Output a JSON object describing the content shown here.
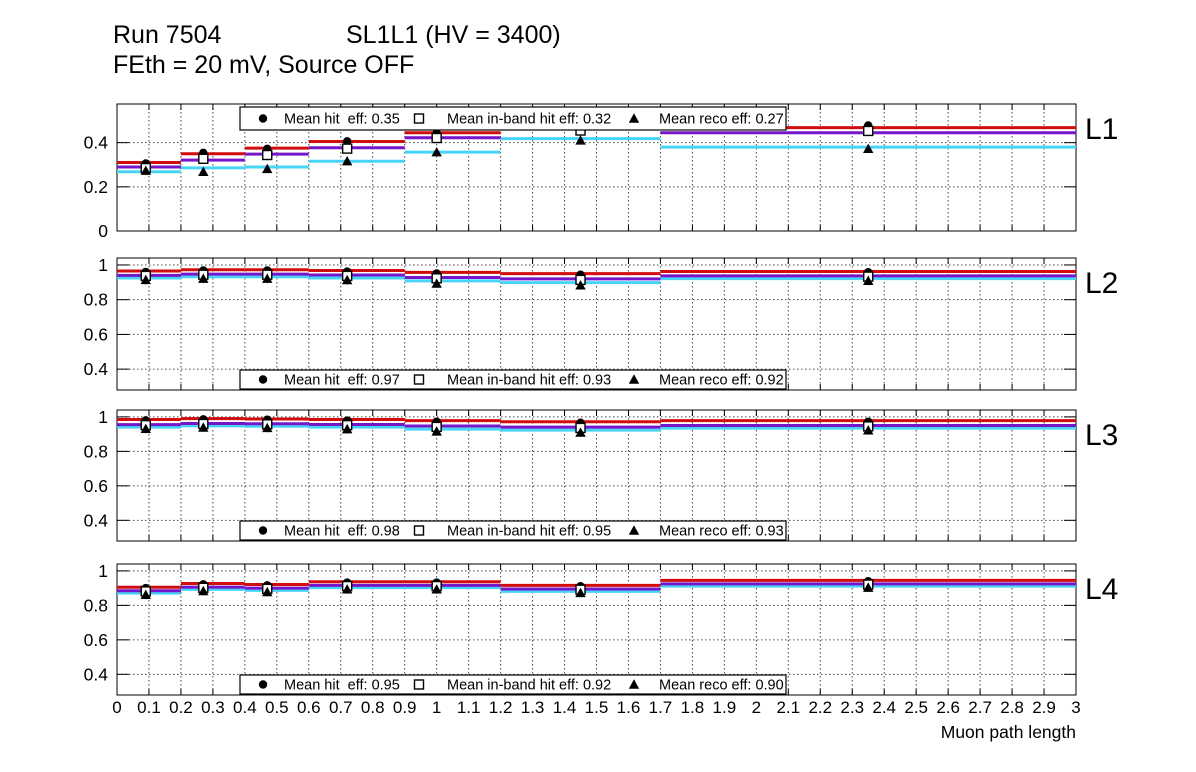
{
  "header": {
    "run_title": "Run 7504",
    "chamber_title": "SL1L1 (HV = 3400)",
    "subtitle": "FEth = 20 mV, Source OFF"
  },
  "colors": {
    "hit_line": "#d10d0d",
    "inband_line": "#7715c9",
    "reco_line": "#47d4f7",
    "marker": "#000000",
    "grid": "#444444"
  },
  "chart_data": {
    "type": "line",
    "xlabel": "Muon path length",
    "xlim": [
      0,
      3
    ],
    "grid": true,
    "x_tick_labels": [
      "0",
      "0.1",
      "0.2",
      "0.3",
      "0.4",
      "0.5",
      "0.6",
      "0.7",
      "0.8",
      "0.9",
      "1",
      "1.1",
      "1.2",
      "1.3",
      "1.4",
      "1.5",
      "1.6",
      "1.7",
      "1.8",
      "1.9",
      "2",
      "2.1",
      "2.2",
      "2.3",
      "2.4",
      "2.5",
      "2.6",
      "2.7",
      "2.8",
      "2.9",
      "3"
    ],
    "bin_edges": [
      0,
      0.2,
      0.4,
      0.6,
      0.9,
      1.2,
      1.7,
      3.0
    ],
    "marker_x": [
      0.09,
      0.27,
      0.47,
      0.72,
      1.0,
      1.45,
      2.35
    ],
    "series_names": [
      "hit",
      "in-band hit",
      "reco"
    ],
    "panels": [
      {
        "label": "L1",
        "ylim": [
          0,
          0.575
        ],
        "yticks": [
          0,
          0.2,
          0.4
        ],
        "ytick_labels": [
          "0",
          "0.2",
          "0.4"
        ],
        "legend_position": "top",
        "legend": [
          {
            "marker": "filled-circle",
            "label": "Mean hit  eff: 0.35"
          },
          {
            "marker": "open-square",
            "label": "Mean in-band hit eff: 0.32"
          },
          {
            "marker": "filled-triangle",
            "label": "Mean reco eff: 0.27"
          }
        ],
        "lines": {
          "hit": [
            0.31,
            0.35,
            0.375,
            0.405,
            0.445,
            0.468,
            0.468
          ],
          "inband": [
            0.29,
            0.321,
            0.348,
            0.377,
            0.422,
            0.462,
            0.445
          ],
          "reco": [
            0.268,
            0.286,
            0.29,
            0.316,
            0.357,
            0.418,
            0.38
          ]
        },
        "markers": {
          "hit": [
            0.306,
            0.354,
            0.372,
            0.406,
            0.443,
            0.472,
            0.478
          ],
          "inband": [
            0.285,
            0.327,
            0.344,
            0.373,
            0.421,
            0.455,
            0.453
          ],
          "reco": [
            0.273,
            0.268,
            0.281,
            0.316,
            0.357,
            0.41,
            0.372
          ]
        }
      },
      {
        "label": "L2",
        "ylim": [
          0.28,
          1.04
        ],
        "yticks": [
          0.4,
          0.6,
          0.8,
          1.0
        ],
        "ytick_labels": [
          "0.4",
          "0.6",
          "0.8",
          "1"
        ],
        "legend_position": "bottom",
        "legend": [
          {
            "marker": "filled-circle",
            "label": "Mean hit  eff: 0.97"
          },
          {
            "marker": "open-square",
            "label": "Mean in-band hit eff: 0.93"
          },
          {
            "marker": "filled-triangle",
            "label": "Mean reco eff: 0.92"
          }
        ],
        "lines": {
          "hit": [
            0.965,
            0.972,
            0.972,
            0.968,
            0.957,
            0.95,
            0.962
          ],
          "inband": [
            0.94,
            0.947,
            0.947,
            0.942,
            0.928,
            0.92,
            0.937
          ],
          "reco": [
            0.925,
            0.932,
            0.932,
            0.925,
            0.908,
            0.898,
            0.921
          ]
        },
        "markers": {
          "hit": [
            0.96,
            0.968,
            0.968,
            0.962,
            0.951,
            0.944,
            0.958
          ],
          "inband": [
            0.937,
            0.944,
            0.944,
            0.937,
            0.923,
            0.914,
            0.933
          ],
          "reco": [
            0.914,
            0.921,
            0.921,
            0.913,
            0.893,
            0.883,
            0.909
          ]
        }
      },
      {
        "label": "L3",
        "ylim": [
          0.28,
          1.04
        ],
        "yticks": [
          0.4,
          0.6,
          0.8,
          1.0
        ],
        "ytick_labels": [
          "0.4",
          "0.6",
          "0.8",
          "1"
        ],
        "legend_position": "bottom",
        "legend": [
          {
            "marker": "filled-circle",
            "label": "Mean hit  eff: 0.98"
          },
          {
            "marker": "open-square",
            "label": "Mean in-band hit eff: 0.95"
          },
          {
            "marker": "filled-triangle",
            "label": "Mean reco eff: 0.93"
          }
        ],
        "lines": {
          "hit": [
            0.985,
            0.99,
            0.988,
            0.985,
            0.978,
            0.972,
            0.978
          ],
          "inband": [
            0.955,
            0.962,
            0.96,
            0.956,
            0.947,
            0.941,
            0.95
          ],
          "reco": [
            0.941,
            0.948,
            0.946,
            0.941,
            0.929,
            0.923,
            0.935
          ]
        },
        "markers": {
          "hit": [
            0.98,
            0.986,
            0.984,
            0.979,
            0.972,
            0.966,
            0.972
          ],
          "inband": [
            0.952,
            0.959,
            0.957,
            0.952,
            0.942,
            0.936,
            0.945
          ],
          "reco": [
            0.931,
            0.938,
            0.936,
            0.929,
            0.916,
            0.909,
            0.922
          ]
        }
      },
      {
        "label": "L4",
        "ylim": [
          0.28,
          1.04
        ],
        "yticks": [
          0.4,
          0.6,
          0.8,
          1.0
        ],
        "ytick_labels": [
          "0.4",
          "0.6",
          "0.8",
          "1"
        ],
        "legend_position": "bottom",
        "legend": [
          {
            "marker": "filled-circle",
            "label": "Mean hit  eff: 0.95"
          },
          {
            "marker": "open-square",
            "label": "Mean in-band hit eff: 0.92"
          },
          {
            "marker": "filled-triangle",
            "label": "Mean reco eff: 0.90"
          }
        ],
        "lines": {
          "hit": [
            0.905,
            0.927,
            0.921,
            0.937,
            0.937,
            0.916,
            0.945
          ],
          "inband": [
            0.885,
            0.906,
            0.9,
            0.916,
            0.916,
            0.895,
            0.925
          ],
          "reco": [
            0.871,
            0.893,
            0.887,
            0.903,
            0.903,
            0.881,
            0.912
          ]
        },
        "markers": {
          "hit": [
            0.9,
            0.922,
            0.916,
            0.932,
            0.932,
            0.911,
            0.94
          ],
          "inband": [
            0.881,
            0.902,
            0.896,
            0.912,
            0.912,
            0.891,
            0.921
          ],
          "reco": [
            0.861,
            0.883,
            0.877,
            0.893,
            0.893,
            0.872,
            0.903
          ]
        }
      }
    ]
  }
}
